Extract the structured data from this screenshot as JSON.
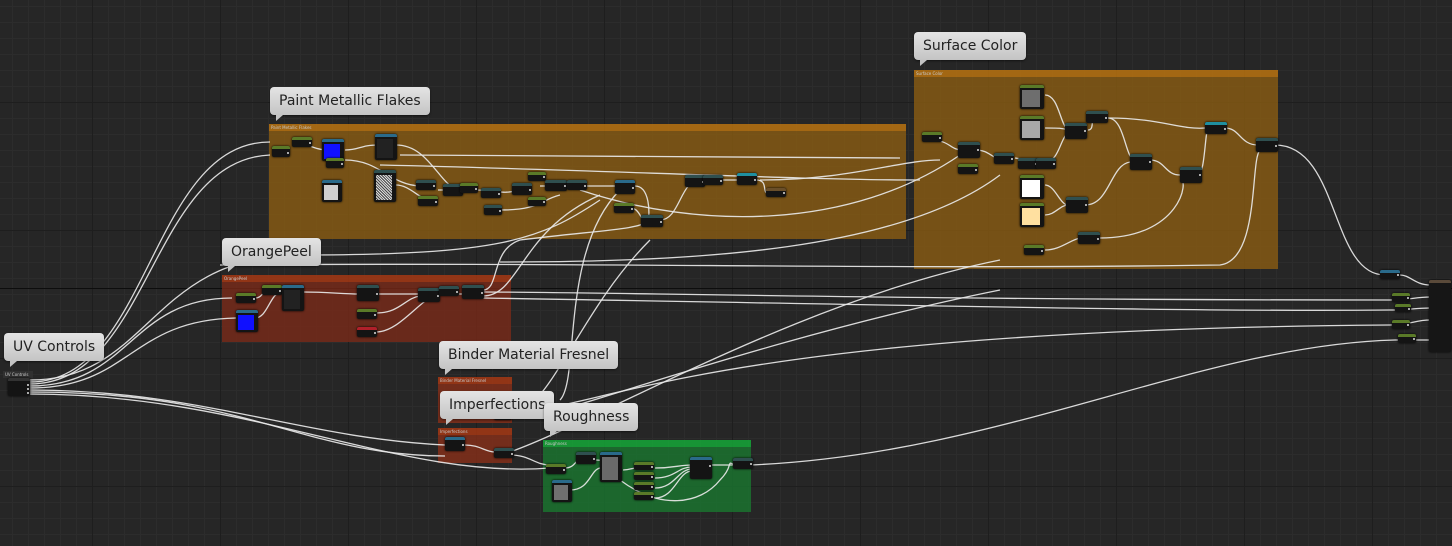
{
  "comments": {
    "surface_color": "Surface Color",
    "paint_metallic_flakes": "Paint Metallic Flakes",
    "orange_peel": "OrangePeel",
    "uv_controls": "UV Controls",
    "binder_material_fresnel": "Binder Material Fresnel",
    "imperfections": "Imperfections",
    "roughness": "Roughness"
  },
  "colors": {
    "surface_color_group": "#9c6516",
    "paint_metallic_group": "#9c6516",
    "orange_peel_group": "#8a2e1a",
    "binder_fresnel_group": "#a33a1c",
    "imperfections_group": "#a33a1c",
    "roughness_group": "#1d8c36",
    "wire": "#e8e8e8",
    "node_body": "#141414",
    "constant_header": "#5a7a28",
    "texture_header": "#2a6a8a",
    "math_header": "#2f4f4f"
  },
  "nodes": {
    "result_node": "material-output-node"
  }
}
